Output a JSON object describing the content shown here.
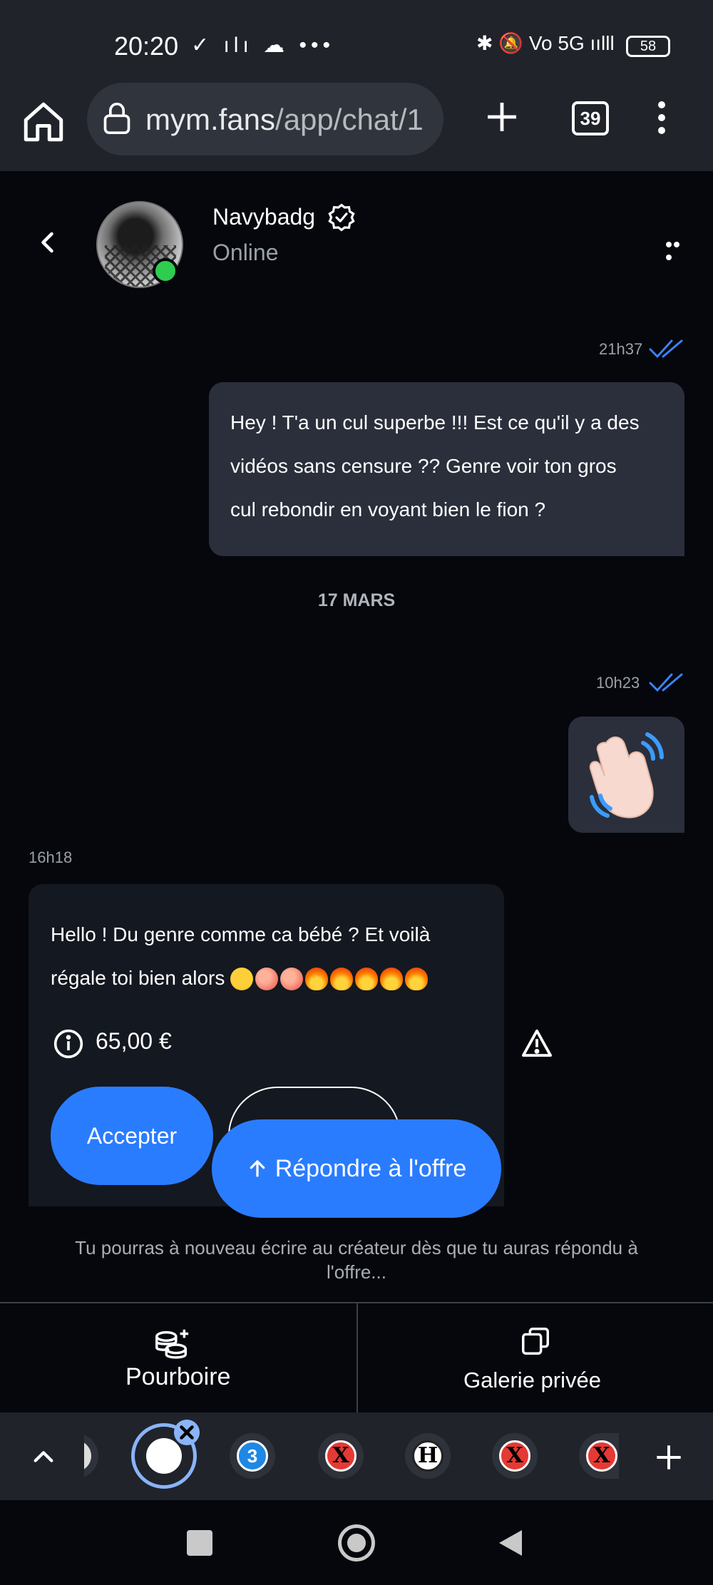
{
  "status_bar": {
    "time": "20:20",
    "left_icons": "✓ ılı ☁ •••",
    "right_icons": "✱ 🔕 Vo 5G ıılll",
    "battery": "58"
  },
  "browser": {
    "url_domain": "mym.fans",
    "url_path": "/app/chat/1",
    "tab_count": "39"
  },
  "chat_header": {
    "name": "Navybadg",
    "status": "Online"
  },
  "messages": [
    {
      "time": "21h37",
      "text_lines": [
        "Hey ! T'a un cul superbe !!! Est ce qu'il y a des",
        "vidéos sans censure ?? Genre voir ton gros",
        "cul rebondir en voyant bien le fion ?"
      ]
    },
    {
      "time": "10h23",
      "emoji": "waving-hand"
    },
    {
      "time": "16h18",
      "text_line1": "Hello ! Du genre comme ca bébé ? Et voilà",
      "text_line2": "régale toi bien alors",
      "emojis": [
        "star-struck",
        "peach",
        "peach",
        "fire",
        "fire",
        "fire",
        "fire",
        "fire"
      ],
      "price": "65,00 €",
      "accept_label": "Accepter",
      "respond_label": "Répondre à l'offre"
    }
  ],
  "date_separator": "17 MARS",
  "notice": "Tu pourras à nouveau écrire au créateur dès que tu auras répondu à l'offre...",
  "actions": {
    "tip_label": "Pourboire",
    "gallery_label": "Galerie privée"
  },
  "tab_strip": {
    "tabs": [
      "3",
      "X",
      "H",
      "X",
      "X"
    ]
  },
  "colors": {
    "accent": "#2a7cff",
    "online": "#2ecc4f",
    "bubble_out": "#2a2f3b",
    "bubble_in": "#141820"
  }
}
